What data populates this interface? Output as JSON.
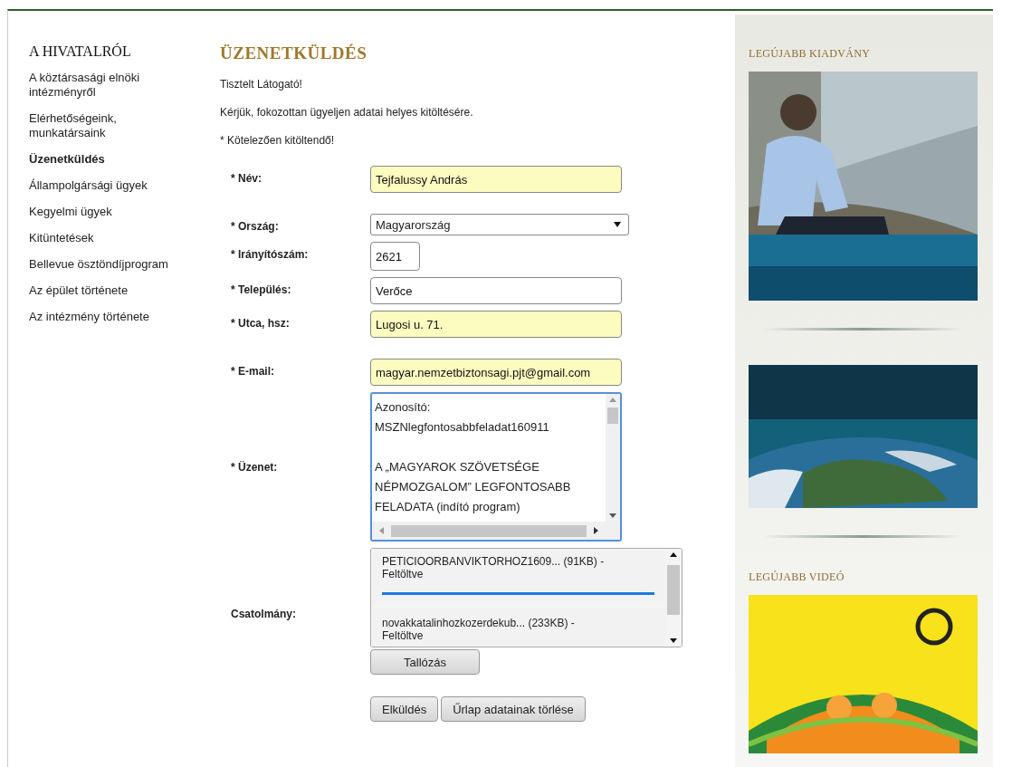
{
  "nav": {
    "title": "A HIVATALRÓL",
    "items": [
      {
        "label": "A köztársasági elnöki intézményről",
        "selected": false
      },
      {
        "label": "Elérhetőségeink, munkatársaink",
        "selected": false
      },
      {
        "label": "Üzenetküldés",
        "selected": true
      },
      {
        "label": "Állampolgársági ügyek",
        "selected": false
      },
      {
        "label": "Kegyelmi ügyek",
        "selected": false
      },
      {
        "label": "Kitüntetések",
        "selected": false
      },
      {
        "label": "Bellevue ösztöndíjprogram",
        "selected": false
      },
      {
        "label": "Az épület története",
        "selected": false
      },
      {
        "label": "Az intézmény története",
        "selected": false
      }
    ]
  },
  "main": {
    "title": "ÜZENETKÜLDÉS",
    "intro": [
      "Tisztelt Látogató!",
      "Kérjük, fokozottan ügyeljen adatai helyes kitöltésére.",
      "* Kötelezően kitöltendő!"
    ],
    "fields": [
      {
        "kind": "text",
        "label": "* Név:",
        "value": "Tejfalussy András",
        "autofilled": true
      },
      {
        "kind": "select",
        "label": "* Ország:",
        "value": "Magyarország"
      },
      {
        "kind": "short",
        "label": "* Irányítószám:",
        "value": "2621",
        "autofilled": false
      },
      {
        "kind": "text",
        "label": "* Település:",
        "value": "Verőce",
        "autofilled": false
      },
      {
        "kind": "text",
        "label": "* Utca, hsz:",
        "value": "Lugosi u. 71.",
        "autofilled": true
      },
      {
        "kind": "text",
        "label": "* E-mail:",
        "value": "magyar.nemzetbiztonsagi.pjt@gmail.com",
        "autofilled": true
      },
      {
        "kind": "textarea",
        "label": "* Üzenet:",
        "value": "Azonosító:\nMSZNlegfontosabbfeladat160911\n\nA „MAGYAROK SZÖVETSÉGE NÉPMOZGALOM” LEGFONTOSABB FELADATA (indító program)"
      },
      {
        "kind": "files",
        "label": "Csatolmány:",
        "files": [
          {
            "name": "PETICIOORBANVIKTORHOZ1609... (91KB) -",
            "status": "Feltöltve",
            "level": 1
          },
          {
            "name": "novakkatalinhozkozerdekub... (233KB) -",
            "status": "Feltöltve"
          }
        ],
        "browse": "Tallózás"
      }
    ],
    "buttons": [
      "Elküldés",
      "Űrlap adatainak törlése"
    ]
  },
  "sidebar": [
    {
      "title": "LEGÚJABB KIADVÁNY",
      "kind": "picture"
    },
    {
      "kind": "picture"
    },
    {
      "title": "LEGÚJABB VIDEÓ",
      "kind": "picture"
    }
  ]
}
